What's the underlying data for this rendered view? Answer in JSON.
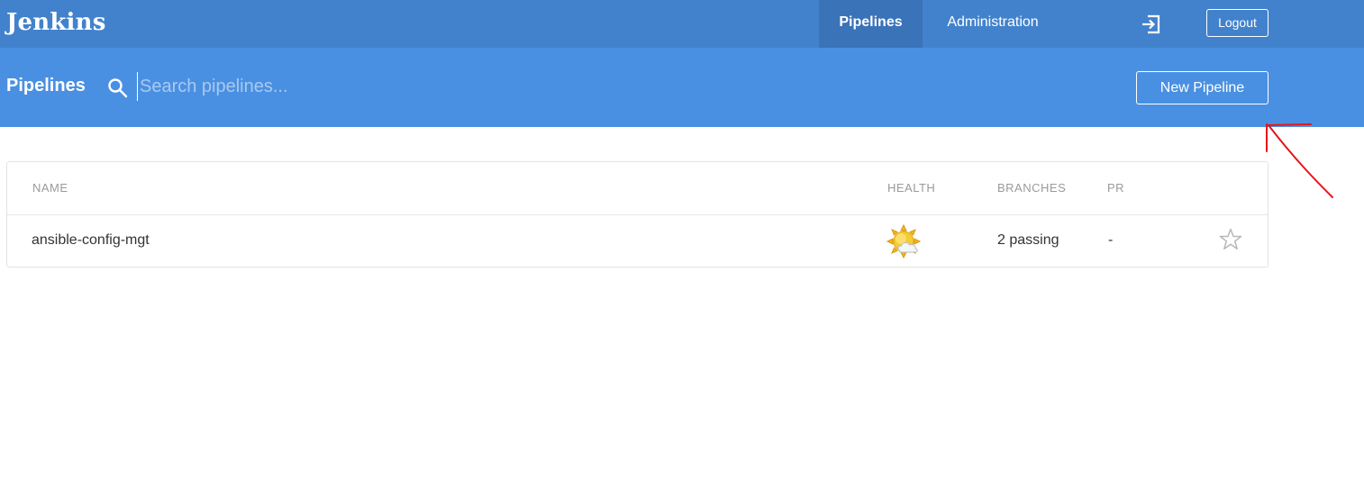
{
  "app": {
    "brand": "Jenkins"
  },
  "nav": {
    "tabs": [
      {
        "label": "Pipelines",
        "active": true
      },
      {
        "label": "Administration",
        "active": false
      }
    ],
    "exit_icon": "exit-icon",
    "logout_label": "Logout"
  },
  "subheader": {
    "title": "Pipelines",
    "search_icon": "search-icon",
    "search_placeholder": "Search pipelines...",
    "search_value": "",
    "new_pipeline_label": "New Pipeline"
  },
  "table": {
    "columns": [
      "NAME",
      "HEALTH",
      "BRANCHES",
      "PR"
    ],
    "rows": [
      {
        "name": "ansible-config-mgt",
        "health_icon": "partly-sunny-weather-icon",
        "branches": "2 passing",
        "pr": "-",
        "favorite": false
      }
    ]
  },
  "colors": {
    "topbar": "#4282cc",
    "topbar_active_tab": "#3a73b8",
    "subheader": "#4a90e2",
    "annotation": "#e8141b"
  }
}
